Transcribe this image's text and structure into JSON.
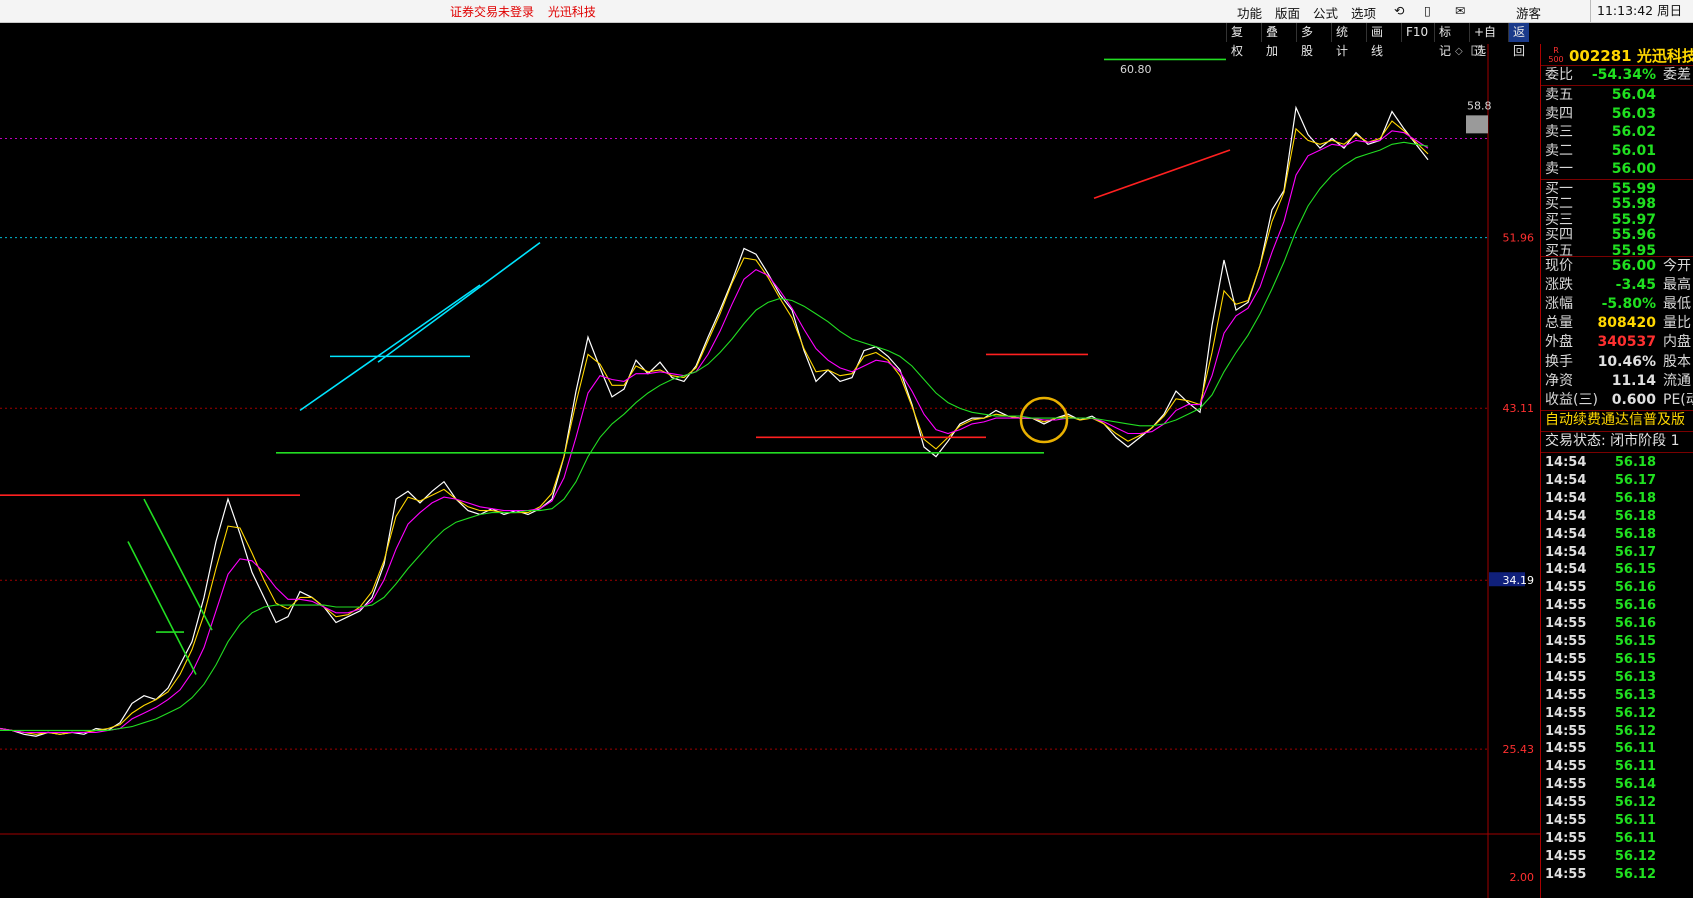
{
  "title_bar": {
    "notice_login": "证券交易未登录",
    "notice_stock": "光迅科技",
    "menu": [
      "功能",
      "版面",
      "公式",
      "选项"
    ],
    "user": "游客",
    "time": "11:13:42 周日"
  },
  "toolbar": {
    "buttons": [
      "复权",
      "叠加",
      "多股",
      "统计",
      "画线",
      "F10",
      "标记",
      "+自选",
      "返回"
    ]
  },
  "stock": {
    "code": "002281",
    "name": "光迅科技",
    "badge_top": "R",
    "badge_bottom": "500"
  },
  "price_axis": {
    "labels": [
      "51.96",
      "43.11",
      "34.19",
      "25.43",
      "2.00"
    ],
    "high_marker": "60.80",
    "right_marker": "58.8"
  },
  "order_book": {
    "ratio_label": "委比",
    "ratio_value": "-54.34%",
    "diff_label": "委差",
    "asks": [
      {
        "label": "卖五",
        "price": "56.04"
      },
      {
        "label": "卖四",
        "price": "56.03"
      },
      {
        "label": "卖三",
        "price": "56.02"
      },
      {
        "label": "卖二",
        "price": "56.01"
      },
      {
        "label": "卖一",
        "price": "56.00"
      }
    ],
    "bids": [
      {
        "label": "买一",
        "price": "55.99"
      },
      {
        "label": "买二",
        "price": "55.98"
      },
      {
        "label": "买三",
        "price": "55.97"
      },
      {
        "label": "买四",
        "price": "55.96"
      },
      {
        "label": "买五",
        "price": "55.95"
      }
    ]
  },
  "quote": [
    {
      "label": "现价",
      "value": "56.00",
      "color": "g",
      "ext": "今开"
    },
    {
      "label": "涨跌",
      "value": "-3.45",
      "color": "g",
      "ext": "最高"
    },
    {
      "label": "涨幅",
      "value": "-5.80%",
      "color": "g",
      "ext": "最低"
    },
    {
      "label": "总量",
      "value": "808420",
      "color": "y",
      "ext": "量比"
    },
    {
      "label": "外盘",
      "value": "340537",
      "color": "r",
      "ext": "内盘"
    },
    {
      "label": "换手",
      "value": "10.46%",
      "color": "w",
      "ext": "股本"
    },
    {
      "label": "净资",
      "value": "11.14",
      "color": "w",
      "ext": "流通"
    },
    {
      "label": "收益(三)",
      "value": "0.600",
      "color": "w",
      "ext": "PE(动)"
    }
  ],
  "news_ticker": "自动续费通达信普及版",
  "trade_status": "交易状态: 闭市阶段 1",
  "ticks": [
    {
      "time": "14:54",
      "price": "56.18"
    },
    {
      "time": "14:54",
      "price": "56.17"
    },
    {
      "time": "14:54",
      "price": "56.18"
    },
    {
      "time": "14:54",
      "price": "56.18"
    },
    {
      "time": "14:54",
      "price": "56.18"
    },
    {
      "time": "14:54",
      "price": "56.17"
    },
    {
      "time": "14:54",
      "price": "56.15"
    },
    {
      "time": "14:55",
      "price": "56.16"
    },
    {
      "time": "14:55",
      "price": "56.16"
    },
    {
      "time": "14:55",
      "price": "56.16"
    },
    {
      "time": "14:55",
      "price": "56.15"
    },
    {
      "time": "14:55",
      "price": "56.15"
    },
    {
      "time": "14:55",
      "price": "56.13"
    },
    {
      "time": "14:55",
      "price": "56.13"
    },
    {
      "time": "14:55",
      "price": "56.12"
    },
    {
      "time": "14:55",
      "price": "56.12"
    },
    {
      "time": "14:55",
      "price": "56.11"
    },
    {
      "time": "14:55",
      "price": "56.11"
    },
    {
      "time": "14:55",
      "price": "56.14"
    },
    {
      "time": "14:55",
      "price": "56.12"
    },
    {
      "time": "14:55",
      "price": "56.11"
    },
    {
      "time": "14:55",
      "price": "56.11"
    },
    {
      "time": "14:55",
      "price": "56.12"
    },
    {
      "time": "14:55",
      "price": "56.12"
    }
  ],
  "chart_data": {
    "type": "line",
    "title": "",
    "price_ticks": [
      51.96,
      43.11,
      34.19,
      25.43
    ],
    "ylim": [
      23.0,
      62.0
    ],
    "x": [
      0,
      12,
      24,
      36,
      48,
      60,
      72,
      84,
      96,
      108,
      120,
      132,
      144,
      156,
      168,
      180,
      192,
      204,
      216,
      228,
      240,
      252,
      264,
      276,
      288,
      300,
      312,
      324,
      336,
      348,
      360,
      372,
      384,
      396,
      408,
      420,
      432,
      444,
      456,
      468,
      480,
      492,
      504,
      516,
      528,
      540,
      552,
      564,
      576,
      588,
      600,
      612,
      624,
      636,
      648,
      660,
      672,
      684,
      696,
      708,
      720,
      732,
      744,
      756,
      768,
      780,
      792,
      804,
      816,
      828,
      840,
      852,
      864,
      876,
      888,
      900,
      912,
      924,
      936,
      948,
      960,
      972,
      984,
      996,
      1008,
      1020,
      1032,
      1044,
      1056,
      1068,
      1080,
      1092,
      1104,
      1116,
      1128,
      1140,
      1152,
      1164,
      1176,
      1188,
      1200,
      1212,
      1224,
      1236,
      1248,
      1260,
      1272,
      1284,
      1296,
      1308,
      1320,
      1332,
      1344,
      1356,
      1368,
      1380,
      1392,
      1404,
      1416,
      1428,
      1440,
      1452,
      1464,
      1476,
      1488
    ],
    "series": [
      {
        "color": "#ffffff",
        "values": [
          26.5,
          26.4,
          26.2,
          26.1,
          26.3,
          26.2,
          26.3,
          26.2,
          26.5,
          26.4,
          26.8,
          27.8,
          28.2,
          28.0,
          28.6,
          29.8,
          31.0,
          33.3,
          36.2,
          38.4,
          36.6,
          34.6,
          33.3,
          32.0,
          32.3,
          33.6,
          33.3,
          32.8,
          32.0,
          32.3,
          32.6,
          33.3,
          35.0,
          38.4,
          38.8,
          38.2,
          38.8,
          39.3,
          38.4,
          37.8,
          37.6,
          37.9,
          37.6,
          37.8,
          37.6,
          37.9,
          38.4,
          40.6,
          44.0,
          46.8,
          45.2,
          43.7,
          44.1,
          45.6,
          44.9,
          45.5,
          44.7,
          44.5,
          45.3,
          46.8,
          48.2,
          49.7,
          51.4,
          51.1,
          50.1,
          49.0,
          48.2,
          46.1,
          44.5,
          45.1,
          44.5,
          44.7,
          46.1,
          46.3,
          45.8,
          45.1,
          43.3,
          41.1,
          40.6,
          41.4,
          42.3,
          42.6,
          42.6,
          43.0,
          42.7,
          42.6,
          42.6,
          42.3,
          42.6,
          42.8,
          42.5,
          42.7,
          42.3,
          41.6,
          41.1,
          41.6,
          42.1,
          42.8,
          44.0,
          43.4,
          42.9,
          47.4,
          50.8,
          48.2,
          48.6,
          50.5,
          53.4,
          54.4,
          58.7,
          57.3,
          56.6,
          57.1,
          56.6,
          57.4,
          56.8,
          57.0,
          58.5,
          57.6,
          56.8,
          56.0
        ]
      },
      {
        "color": "#ffd700",
        "values": [
          26.5,
          26.4,
          26.3,
          26.2,
          26.3,
          26.2,
          26.3,
          26.3,
          26.4,
          26.5,
          26.7,
          27.3,
          27.7,
          28.0,
          28.4,
          29.3,
          30.6,
          32.4,
          34.8,
          37.0,
          36.9,
          35.6,
          34.2,
          33.0,
          32.7,
          33.3,
          33.3,
          32.8,
          32.3,
          32.4,
          32.8,
          33.6,
          35.2,
          37.5,
          38.5,
          38.3,
          38.6,
          38.9,
          38.4,
          38.0,
          37.8,
          37.8,
          37.7,
          37.7,
          37.7,
          38.0,
          38.7,
          40.6,
          43.4,
          45.9,
          45.4,
          44.3,
          44.3,
          45.3,
          45.0,
          45.1,
          44.8,
          44.7,
          45.2,
          46.6,
          48.0,
          49.6,
          50.9,
          50.8,
          49.9,
          48.8,
          47.8,
          46.2,
          45.0,
          45.1,
          44.8,
          44.9,
          45.8,
          46.0,
          45.6,
          44.8,
          43.2,
          41.5,
          41.0,
          41.6,
          42.2,
          42.5,
          42.6,
          42.8,
          42.7,
          42.6,
          42.6,
          42.4,
          42.6,
          42.7,
          42.5,
          42.6,
          42.3,
          41.8,
          41.4,
          41.7,
          42.1,
          42.7,
          43.6,
          43.5,
          43.3,
          46.0,
          49.2,
          48.5,
          48.7,
          50.5,
          52.8,
          54.3,
          57.6,
          57.0,
          56.8,
          57.0,
          56.8,
          57.3,
          56.9,
          57.1,
          58.0,
          57.5,
          56.9,
          56.3
        ]
      },
      {
        "color": "#ff00ff",
        "values": [
          26.5,
          26.4,
          26.3,
          26.3,
          26.3,
          26.3,
          26.3,
          26.3,
          26.3,
          26.4,
          26.5,
          27.0,
          27.3,
          27.6,
          28.0,
          28.5,
          29.4,
          30.7,
          32.6,
          34.5,
          35.3,
          35.2,
          34.6,
          33.8,
          33.2,
          33.2,
          33.1,
          32.8,
          32.5,
          32.5,
          32.7,
          33.1,
          34.2,
          35.8,
          37.1,
          37.7,
          38.2,
          38.5,
          38.4,
          38.2,
          38.0,
          37.9,
          37.8,
          37.8,
          37.8,
          37.9,
          38.3,
          39.5,
          41.6,
          43.9,
          44.8,
          44.6,
          44.5,
          44.9,
          44.9,
          45.0,
          44.9,
          44.8,
          45.0,
          45.9,
          47.1,
          48.5,
          49.8,
          50.3,
          50.0,
          49.2,
          48.3,
          47.2,
          46.2,
          45.6,
          45.2,
          45.0,
          45.3,
          45.6,
          45.5,
          45.0,
          44.0,
          42.8,
          42.0,
          41.8,
          42.0,
          42.3,
          42.4,
          42.6,
          42.6,
          42.6,
          42.6,
          42.5,
          42.5,
          42.6,
          42.6,
          42.6,
          42.4,
          42.1,
          41.8,
          41.8,
          41.9,
          42.3,
          43.0,
          43.3,
          43.3,
          44.8,
          47.0,
          47.9,
          48.3,
          49.4,
          51.2,
          52.8,
          55.2,
          56.2,
          56.5,
          56.8,
          56.7,
          57.0,
          56.9,
          57.0,
          57.5,
          57.4,
          57.0,
          56.6
        ]
      },
      {
        "color": "#22dd22",
        "values": [
          26.4,
          26.4,
          26.4,
          26.4,
          26.4,
          26.4,
          26.4,
          26.4,
          26.4,
          26.4,
          26.5,
          26.6,
          26.8,
          27.0,
          27.3,
          27.6,
          28.1,
          28.8,
          29.8,
          31.0,
          31.9,
          32.5,
          32.8,
          32.9,
          32.9,
          32.9,
          32.9,
          32.9,
          32.8,
          32.8,
          32.8,
          32.9,
          33.3,
          34.0,
          34.8,
          35.5,
          36.2,
          36.8,
          37.2,
          37.4,
          37.6,
          37.7,
          37.7,
          37.7,
          37.8,
          37.8,
          37.9,
          38.4,
          39.3,
          40.6,
          41.6,
          42.3,
          42.8,
          43.4,
          43.9,
          44.3,
          44.6,
          44.8,
          45.0,
          45.4,
          46.0,
          46.7,
          47.5,
          48.2,
          48.6,
          48.8,
          48.7,
          48.4,
          48.0,
          47.6,
          47.1,
          46.7,
          46.5,
          46.3,
          46.1,
          45.8,
          45.3,
          44.6,
          43.9,
          43.4,
          43.1,
          42.9,
          42.8,
          42.7,
          42.7,
          42.7,
          42.6,
          42.6,
          42.6,
          42.6,
          42.6,
          42.6,
          42.5,
          42.4,
          42.3,
          42.2,
          42.2,
          42.3,
          42.5,
          42.8,
          43.1,
          43.8,
          45.0,
          46.0,
          46.9,
          48.0,
          49.3,
          50.7,
          52.3,
          53.6,
          54.5,
          55.2,
          55.7,
          56.1,
          56.3,
          56.5,
          56.8,
          56.9,
          56.8,
          56.7
        ]
      }
    ],
    "trend_lines": [
      {
        "color": "#ff2020",
        "from": [
          0,
          38.6
        ],
        "to": [
          300,
          38.6
        ]
      },
      {
        "color": "#22dd22",
        "from": [
          276,
          40.8
        ],
        "to": [
          1044,
          40.8
        ]
      },
      {
        "color": "#22dd22",
        "from": [
          144,
          38.4
        ],
        "to": [
          212,
          31.6
        ]
      },
      {
        "color": "#22dd22",
        "from": [
          128,
          36.2
        ],
        "to": [
          196,
          29.3
        ]
      },
      {
        "color": "#22dd22",
        "from": [
          156,
          31.5
        ],
        "to": [
          184,
          31.5
        ]
      },
      {
        "color": "#00e5ff",
        "from": [
          300,
          43.0
        ],
        "to": [
          480,
          49.5
        ]
      },
      {
        "color": "#00e5ff",
        "from": [
          378,
          45.5
        ],
        "to": [
          540,
          51.7
        ]
      },
      {
        "color": "#00e5ff",
        "from": [
          330,
          45.8
        ],
        "to": [
          470,
          45.8
        ]
      },
      {
        "color": "#ff2020",
        "from": [
          756,
          41.6
        ],
        "to": [
          986,
          41.6
        ]
      },
      {
        "color": "#ff2020",
        "from": [
          986,
          45.9
        ],
        "to": [
          1088,
          45.9
        ]
      },
      {
        "color": "#ff2020",
        "from": [
          1094,
          54.0
        ],
        "to": [
          1230,
          56.5
        ]
      },
      {
        "color": "#22dd22",
        "from": [
          1104,
          61.2
        ],
        "to": [
          1226,
          61.2
        ]
      }
    ],
    "highlight_circle_at": [
      1044,
      42.5
    ]
  }
}
